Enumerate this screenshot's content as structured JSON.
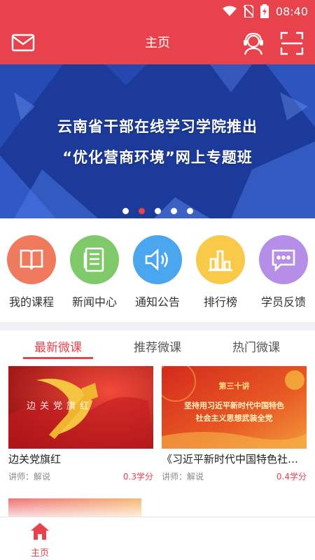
{
  "status_bar": {
    "time": "08:40"
  },
  "header": {
    "title": "主页"
  },
  "banner": {
    "line1": "云南省干部在线学习学院推出",
    "line2": "“优化营商环境”网上专题班",
    "dots_count": 5,
    "active_dot": 2
  },
  "quick_menu": [
    {
      "label": "我的课程",
      "icon": "book-icon",
      "color": "#f07a5e"
    },
    {
      "label": "新闻中心",
      "icon": "news-icon",
      "color": "#7fc96a"
    },
    {
      "label": "通知公告",
      "icon": "speaker-icon",
      "color": "#4aa6ee"
    },
    {
      "label": "排行榜",
      "icon": "bar-chart-icon",
      "color": "#f9c94a"
    },
    {
      "label": "学员反馈",
      "icon": "feedback-icon",
      "color": "#b68ee8"
    }
  ],
  "tabs": [
    {
      "label": "最新微课",
      "active": true
    },
    {
      "label": "推荐微课",
      "active": false
    },
    {
      "label": "热门微课",
      "active": false
    }
  ],
  "courses": [
    {
      "title": "边关党旗红",
      "thumb_text": "边关党旗红",
      "teacher": "讲师：解说",
      "credit": "0.3学分"
    },
    {
      "title": "《习近平新时代中国特色社…",
      "thumb_line1": "第三十讲",
      "thumb_line2": "坚持用习近平新时代中国特色",
      "thumb_line3": "社会主义思想武装全党",
      "teacher": "讲师：解说",
      "credit": "0.4学分"
    }
  ],
  "bottom_nav": {
    "home_label": "主页"
  },
  "colors": {
    "brand": "#e8434c",
    "banner_blue": "#1b3a9a"
  }
}
